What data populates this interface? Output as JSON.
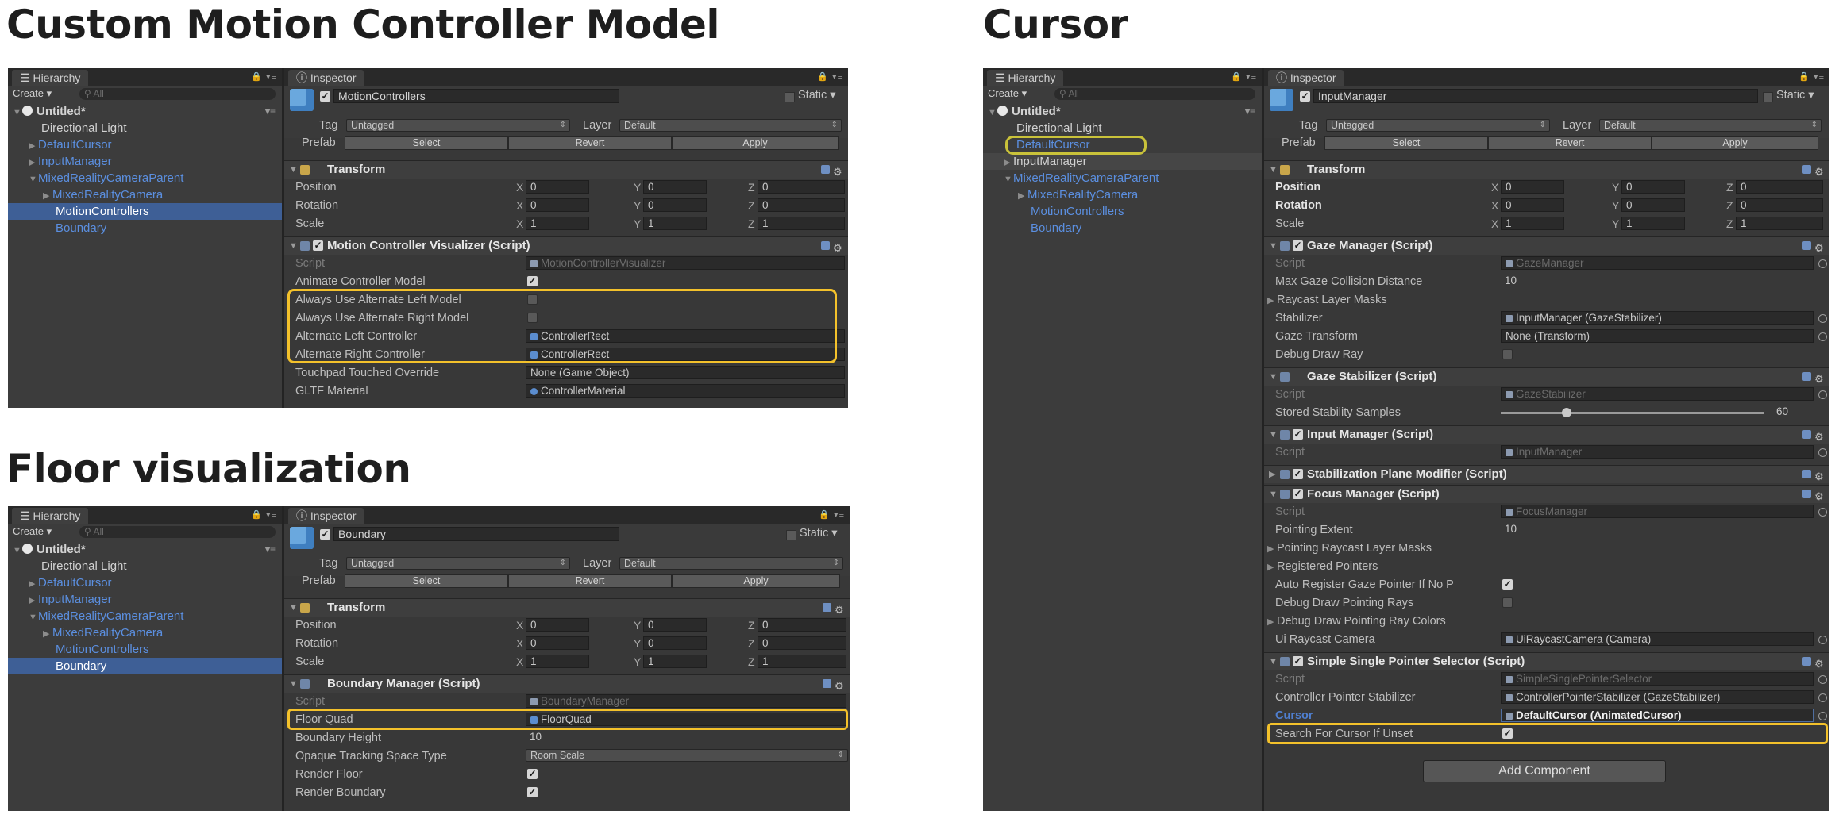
{
  "headings": {
    "motion": "Custom Motion Controller Model",
    "floor": "Floor visualization",
    "cursor": "Cursor"
  },
  "ui": {
    "hierarchy_tab": "Hierarchy",
    "inspector_tab": "Inspector",
    "create": "Create ▾",
    "search_placeholder": "All",
    "static": "Static",
    "tag": "Tag",
    "layer": "Layer",
    "prefab": "Prefab",
    "select": "Select",
    "revert": "Revert",
    "apply": "Apply",
    "transform": "Transform",
    "position": "Position",
    "rotation": "Rotation",
    "scale": "Scale",
    "x": "X",
    "y": "Y",
    "z": "Z",
    "untagged": "Untagged",
    "default_layer": "Default",
    "script": "Script",
    "add_component": "Add Component"
  },
  "hierarchy_items": {
    "untitled": "Untitled*",
    "directional_light": "Directional Light",
    "default_cursor": "DefaultCursor",
    "input_manager": "InputManager",
    "mr_camera_parent": "MixedRealityCameraParent",
    "mr_camera": "MixedRealityCamera",
    "motion_controllers": "MotionControllers",
    "boundary": "Boundary"
  },
  "motion": {
    "object_name": "MotionControllers",
    "position": [
      "0",
      "0",
      "0"
    ],
    "rotation": [
      "0",
      "0",
      "0"
    ],
    "scale": [
      "1",
      "1",
      "1"
    ],
    "component": "Motion Controller Visualizer (Script)",
    "script_value": "MotionControllerVisualizer",
    "props": {
      "animate": "Animate Controller Model",
      "alt_left_model": "Always Use Alternate Left Model",
      "alt_right_model": "Always Use Alternate Right Model",
      "alt_left_ctrl": "Alternate Left Controller",
      "alt_right_ctrl": "Alternate Right Controller",
      "touchpad": "Touchpad Touched Override",
      "gltf": "GLTF Material"
    },
    "values": {
      "alt_left_ctrl": "ControllerRect",
      "alt_right_ctrl": "ControllerRect",
      "touchpad": "None (Game Object)",
      "gltf": "ControllerMaterial"
    }
  },
  "floor": {
    "object_name": "Boundary",
    "position": [
      "0",
      "0",
      "0"
    ],
    "rotation": [
      "0",
      "0",
      "0"
    ],
    "scale": [
      "1",
      "1",
      "1"
    ],
    "component": "Boundary Manager (Script)",
    "script_value": "BoundaryManager",
    "props": {
      "floor_quad": "Floor Quad",
      "boundary_height": "Boundary Height",
      "opaque": "Opaque Tracking Space Type",
      "render_floor": "Render Floor",
      "render_boundary": "Render Boundary"
    },
    "values": {
      "floor_quad": "FloorQuad",
      "boundary_height": "10",
      "opaque": "Room Scale"
    }
  },
  "cursor": {
    "object_name": "InputManager",
    "position": [
      "0",
      "0",
      "0"
    ],
    "rotation": [
      "0",
      "0",
      "0"
    ],
    "scale": [
      "1",
      "1",
      "1"
    ],
    "gaze_manager": {
      "title": "Gaze Manager (Script)",
      "script": "GazeManager",
      "max_dist_label": "Max Gaze Collision Distance",
      "max_dist": "10",
      "raycast_masks": "Raycast Layer Masks",
      "stabilizer_label": "Stabilizer",
      "stabilizer": "InputManager (GazeStabilizer)",
      "gaze_transform_label": "Gaze Transform",
      "gaze_transform": "None (Transform)",
      "debug_ray": "Debug Draw Ray"
    },
    "gaze_stabilizer": {
      "title": "Gaze Stabilizer (Script)",
      "script": "GazeStabilizer",
      "samples_label": "Stored Stability Samples",
      "samples": "60"
    },
    "input_manager": {
      "title": "Input Manager (Script)",
      "script": "InputManager"
    },
    "stabilization": {
      "title": "Stabilization Plane Modifier (Script)"
    },
    "focus_manager": {
      "title": "Focus Manager (Script)",
      "script": "FocusManager",
      "extent_label": "Pointing Extent",
      "extent": "10",
      "pointing_masks": "Pointing Raycast Layer Masks",
      "registered": "Registered Pointers",
      "auto_register": "Auto Register Gaze Pointer If No P",
      "debug_rays": "Debug Draw Pointing Rays",
      "debug_colors": "Debug Draw Pointing Ray Colors",
      "ui_cam_label": "Ui Raycast Camera",
      "ui_cam": "UiRaycastCamera (Camera)"
    },
    "pointer_selector": {
      "title": "Simple Single Pointer Selector (Script)",
      "script": "SimpleSinglePointerSelector",
      "stabilizer_label": "Controller Pointer Stabilizer",
      "stabilizer": "ControllerPointerStabilizer (GazeStabilizer)",
      "cursor_label": "Cursor",
      "cursor": "DefaultCursor (AnimatedCursor)",
      "search_label": "Search For Cursor If Unset"
    }
  },
  "slider_fraction": 0.25,
  "colors": {
    "highlight": "#f3c12b",
    "selection": "#3e5f96",
    "prefab_blue": "#5b8fe0"
  }
}
